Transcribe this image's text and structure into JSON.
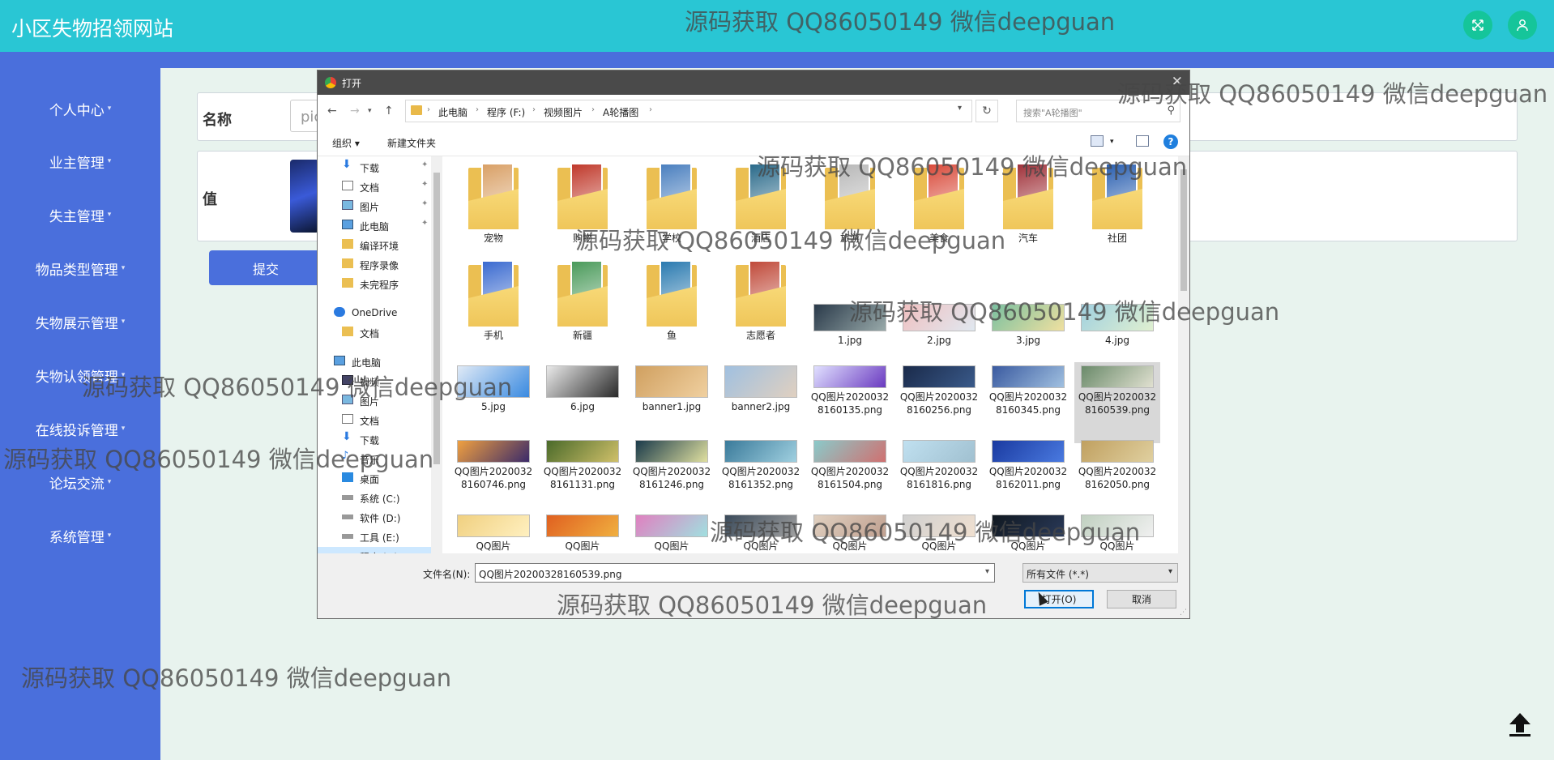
{
  "app": {
    "title": "小区失物招领网站",
    "expand_icon": "fullscreen-icon",
    "user_icon": "user-icon"
  },
  "sidebar": {
    "items": [
      {
        "label": "个人中心"
      },
      {
        "label": "业主管理"
      },
      {
        "label": "失主管理"
      },
      {
        "label": "物品类型管理"
      },
      {
        "label": "失物展示管理"
      },
      {
        "label": "失物认领管理"
      },
      {
        "label": "在线投诉管理"
      },
      {
        "label": "论坛交流"
      },
      {
        "label": "系统管理"
      }
    ]
  },
  "form": {
    "name_label": "名称",
    "name_value": "pic",
    "value_label": "值",
    "submit_label": "提交"
  },
  "watermark": "源码获取 QQ86050149 微信deepguan",
  "dialog": {
    "title": "打开",
    "breadcrumb": [
      "此电脑",
      "程序 (F:)",
      "视频图片",
      "A轮播图"
    ],
    "search_placeholder": "搜索\"A轮播图\"",
    "organize_label": "组织 ▾",
    "new_folder_label": "新建文件夹",
    "nav_items": [
      {
        "label": "下载",
        "icon": "download-arrow",
        "pinned": true
      },
      {
        "label": "文档",
        "icon": "document",
        "pinned": true
      },
      {
        "label": "图片",
        "icon": "picture",
        "pinned": true
      },
      {
        "label": "此电脑",
        "icon": "monitor",
        "pinned": true
      },
      {
        "label": "编译环境",
        "icon": "folder"
      },
      {
        "label": "程序录像",
        "icon": "folder"
      },
      {
        "label": "未完程序",
        "icon": "folder"
      },
      {
        "label": "OneDrive",
        "icon": "cloud"
      },
      {
        "label": "文档",
        "icon": "folder"
      },
      {
        "label": "此电脑",
        "icon": "monitor"
      },
      {
        "label": "视频",
        "icon": "video"
      },
      {
        "label": "图片",
        "icon": "picture"
      },
      {
        "label": "文档",
        "icon": "document"
      },
      {
        "label": "下载",
        "icon": "download-arrow"
      },
      {
        "label": "音乐",
        "icon": "music"
      },
      {
        "label": "桌面",
        "icon": "desktop"
      },
      {
        "label": "系统 (C:)",
        "icon": "drive"
      },
      {
        "label": "软件 (D:)",
        "icon": "drive"
      },
      {
        "label": "工具 (E:)",
        "icon": "drive"
      },
      {
        "label": "程序 (F:)",
        "icon": "drive",
        "selected": true
      }
    ],
    "folders": [
      {
        "name": "宠物",
        "color": "#d9a066"
      },
      {
        "name": "购物",
        "color": "#c0392b"
      },
      {
        "name": "学校",
        "color": "#4a7fbf"
      },
      {
        "name": "酒店",
        "color": "#2a6a8a"
      },
      {
        "name": "旅游",
        "color": "#b8b8b8"
      },
      {
        "name": "美食",
        "color": "#d94a3a"
      },
      {
        "name": "汽车",
        "color": "#a0323a"
      },
      {
        "name": "社团",
        "color": "#2a5fb0"
      },
      {
        "name": "手机",
        "color": "#3a6ad0"
      },
      {
        "name": "新疆",
        "color": "#4a9a5a"
      },
      {
        "name": "鱼",
        "color": "#2a7ab0"
      },
      {
        "name": "志愿者",
        "color": "#c04a3a"
      }
    ],
    "images": [
      {
        "name": "1.jpg",
        "c1": "#2a3a4a",
        "c2": "#9aa"
      },
      {
        "name": "2.jpg",
        "c1": "#f0c0c0",
        "c2": "#e0e8f0"
      },
      {
        "name": "3.jpg",
        "c1": "#7ac0a0",
        "c2": "#f0e0a0"
      },
      {
        "name": "4.jpg",
        "c1": "#a0d0e0",
        "c2": "#e0f0d0"
      },
      {
        "name": "5.jpg",
        "c1": "#e0eaf6",
        "c2": "#3a8ae0"
      },
      {
        "name": "6.jpg",
        "c1": "#eaeaea",
        "c2": "#2a2a2a"
      },
      {
        "name": "banner1.jpg",
        "c1": "#d0a060",
        "c2": "#f0d0a0"
      },
      {
        "name": "banner2.jpg",
        "c1": "#a0c0e0",
        "c2": "#e0d0c0"
      },
      {
        "name": "QQ图片20200328160135.png",
        "c1": "#e0e0ff",
        "c2": "#6a3ac0"
      },
      {
        "name": "QQ图片20200328160256.png",
        "c1": "#1a2a4a",
        "c2": "#3a5a8a"
      },
      {
        "name": "QQ图片20200328160345.png",
        "c1": "#3a5aa0",
        "c2": "#a0c0e0"
      },
      {
        "name": "QQ图片20200328160539.png",
        "c1": "#6a8a6a",
        "c2": "#e0e0d0",
        "selected": true
      },
      {
        "name": "QQ图片20200328160746.png",
        "c1": "#f0a040",
        "c2": "#3a2a6a"
      },
      {
        "name": "QQ图片20200328161131.png",
        "c1": "#4a6a2a",
        "c2": "#d0c06a"
      },
      {
        "name": "QQ图片20200328161246.png",
        "c1": "#1a3a4a",
        "c2": "#e0e0a0"
      },
      {
        "name": "QQ图片20200328161352.png",
        "c1": "#3a7a9a",
        "c2": "#a0d0e0"
      },
      {
        "name": "QQ图片20200328161504.png",
        "c1": "#8acaca",
        "c2": "#d07070"
      },
      {
        "name": "QQ图片20200328161816.png",
        "c1": "#c0e0f0",
        "c2": "#a0c0d0"
      },
      {
        "name": "QQ图片20200328162011.png",
        "c1": "#1a3aa0",
        "c2": "#4a7ae0"
      },
      {
        "name": "QQ图片20200328162050.png",
        "c1": "#c0a060",
        "c2": "#e0d0a0"
      },
      {
        "name": "QQ图片",
        "c1": "#f0d080",
        "c2": "#fff0c0"
      },
      {
        "name": "QQ图片",
        "c1": "#e06020",
        "c2": "#f0b040"
      },
      {
        "name": "QQ图片",
        "c1": "#e080c0",
        "c2": "#a0e0e0"
      },
      {
        "name": "QQ图片",
        "c1": "#3a4a5a",
        "c2": "#a0a0a0"
      },
      {
        "name": "QQ图片",
        "c1": "#e0d0c0",
        "c2": "#c0a090"
      },
      {
        "name": "QQ图片",
        "c1": "#d0d0d0",
        "c2": "#f0e0d0"
      },
      {
        "name": "QQ图片",
        "c1": "#101820",
        "c2": "#2a3a5a"
      },
      {
        "name": "QQ图片",
        "c1": "#c0d0c0",
        "c2": "#f0f0f0"
      }
    ],
    "filename_label": "文件名(N):",
    "filename_value": "QQ图片20200328160539.png",
    "filetype_value": "所有文件 (*.*)",
    "open_label": "打开(O)",
    "cancel_label": "取消"
  }
}
